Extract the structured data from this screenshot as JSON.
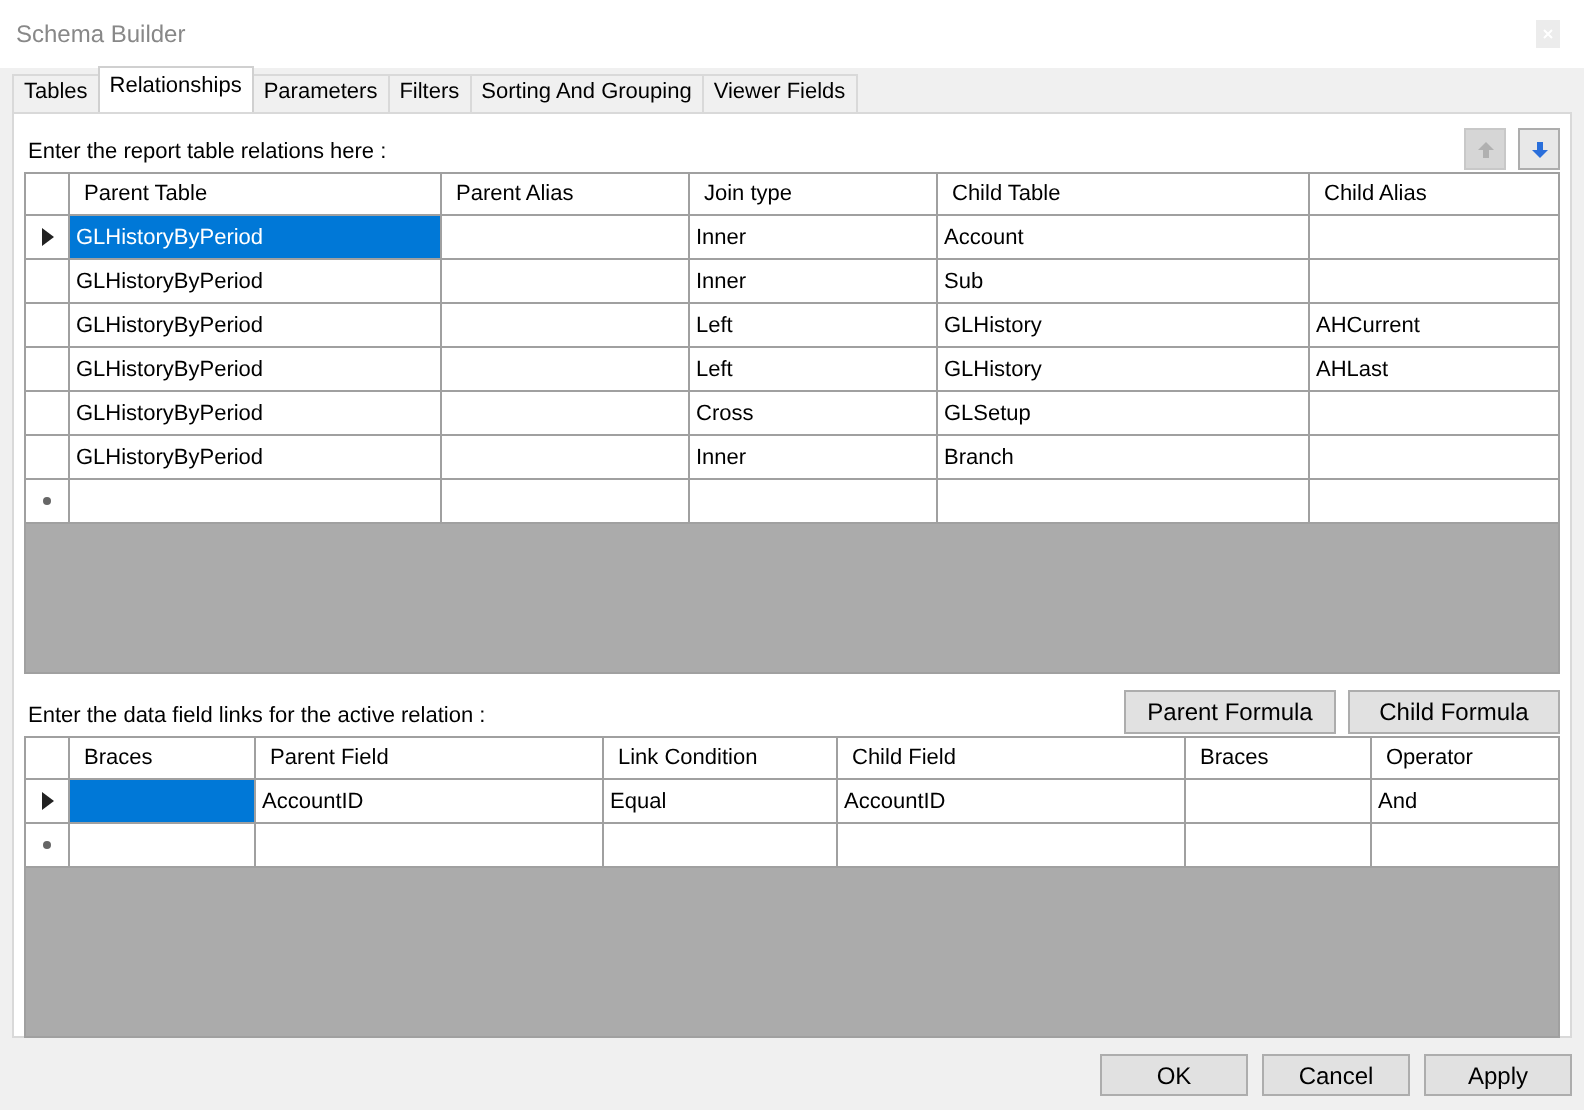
{
  "window": {
    "title": "Schema Builder"
  },
  "tabs": [
    {
      "label": "Tables",
      "selected": false
    },
    {
      "label": "Relationships",
      "selected": true
    },
    {
      "label": "Parameters",
      "selected": false
    },
    {
      "label": "Filters",
      "selected": false
    },
    {
      "label": "Sorting And Grouping",
      "selected": false
    },
    {
      "label": "Viewer Fields",
      "selected": false
    }
  ],
  "relations": {
    "label": "Enter the report table relations here :",
    "move_up": {
      "disabled": true
    },
    "move_down": {
      "disabled": false
    },
    "columns": [
      "Parent Table",
      "Parent Alias",
      "Join type",
      "Child Table",
      "Child Alias"
    ],
    "rows": [
      {
        "selected": true,
        "cells": [
          "GLHistoryByPeriod",
          "",
          "Inner",
          "Account",
          ""
        ]
      },
      {
        "selected": false,
        "cells": [
          "GLHistoryByPeriod",
          "",
          "Inner",
          "Sub",
          ""
        ]
      },
      {
        "selected": false,
        "cells": [
          "GLHistoryByPeriod",
          "",
          "Left",
          "GLHistory",
          "AHCurrent"
        ]
      },
      {
        "selected": false,
        "cells": [
          "GLHistoryByPeriod",
          "",
          "Left",
          "GLHistory",
          "AHLast"
        ]
      },
      {
        "selected": false,
        "cells": [
          "GLHistoryByPeriod",
          "",
          "Cross",
          "GLSetup",
          ""
        ]
      },
      {
        "selected": false,
        "cells": [
          "GLHistoryByPeriod",
          "",
          "Inner",
          "Branch",
          ""
        ]
      }
    ]
  },
  "links": {
    "label": "Enter the data field links for the active relation :",
    "buttons": [
      "Parent Formula",
      "Child Formula"
    ],
    "columns": [
      "Braces",
      "Parent Field",
      "Link Condition",
      "Child Field",
      "Braces",
      "Operator"
    ],
    "rows": [
      {
        "selected": true,
        "cells": [
          "",
          "AccountID",
          "Equal",
          "AccountID",
          "",
          "And"
        ]
      }
    ]
  },
  "buttons": [
    "OK",
    "Cancel",
    "Apply"
  ]
}
